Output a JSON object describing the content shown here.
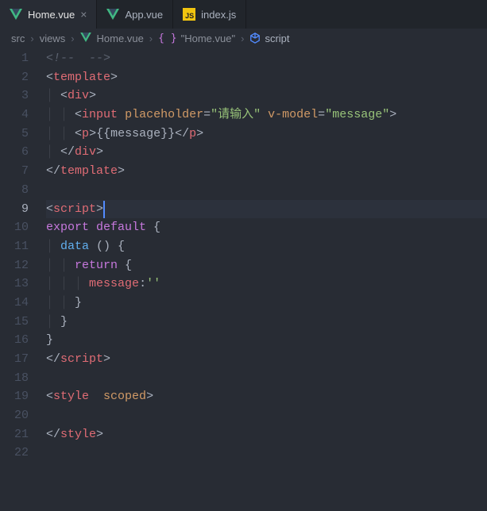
{
  "tabs": [
    {
      "label": "Home.vue",
      "type": "vue",
      "active": true,
      "close": "×"
    },
    {
      "label": "App.vue",
      "type": "vue",
      "active": false
    },
    {
      "label": "index.js",
      "type": "js",
      "active": false
    }
  ],
  "breadcrumbs": {
    "sep": "›",
    "items": [
      {
        "label": "src",
        "icon": null
      },
      {
        "label": "views",
        "icon": null
      },
      {
        "label": "Home.vue",
        "icon": "vue"
      },
      {
        "label": "\"Home.vue\"",
        "icon": "brace"
      },
      {
        "label": "script",
        "icon": "cube"
      }
    ]
  },
  "activeLine": 9,
  "lines": [
    {
      "n": 1,
      "ind": 0,
      "tokens": [
        [
          "<!--  -->",
          "c-comment"
        ]
      ]
    },
    {
      "n": 2,
      "ind": 0,
      "tokens": [
        [
          "<",
          "c-punct"
        ],
        [
          "template",
          "c-tag"
        ],
        [
          ">",
          "c-punct"
        ]
      ]
    },
    {
      "n": 3,
      "ind": 1,
      "tokens": [
        [
          "<",
          "c-punct"
        ],
        [
          "div",
          "c-tag"
        ],
        [
          ">",
          "c-punct"
        ]
      ]
    },
    {
      "n": 4,
      "ind": 2,
      "tokens": [
        [
          "<",
          "c-punct"
        ],
        [
          "input",
          "c-tag"
        ],
        [
          " ",
          "c-default"
        ],
        [
          "placeholder",
          "c-attr"
        ],
        [
          "=",
          "c-punct"
        ],
        [
          "\"请输入\"",
          "c-string"
        ],
        [
          " ",
          "c-default"
        ],
        [
          "v-model",
          "c-attr"
        ],
        [
          "=",
          "c-punct"
        ],
        [
          "\"message\"",
          "c-string"
        ],
        [
          ">",
          "c-punct"
        ]
      ]
    },
    {
      "n": 5,
      "ind": 2,
      "tokens": [
        [
          "<",
          "c-punct"
        ],
        [
          "p",
          "c-tag"
        ],
        [
          ">",
          "c-punct"
        ],
        [
          "{{message}}",
          "c-default"
        ],
        [
          "</",
          "c-punct"
        ],
        [
          "p",
          "c-tag"
        ],
        [
          ">",
          "c-punct"
        ]
      ]
    },
    {
      "n": 6,
      "ind": 1,
      "tokens": [
        [
          "</",
          "c-punct"
        ],
        [
          "div",
          "c-tag"
        ],
        [
          ">",
          "c-punct"
        ]
      ]
    },
    {
      "n": 7,
      "ind": 0,
      "tokens": [
        [
          "</",
          "c-punct"
        ],
        [
          "template",
          "c-tag"
        ],
        [
          ">",
          "c-punct"
        ]
      ]
    },
    {
      "n": 8,
      "ind": 0,
      "tokens": []
    },
    {
      "n": 9,
      "ind": 0,
      "tokens": [
        [
          "<",
          "c-punct"
        ],
        [
          "script",
          "c-tag"
        ],
        [
          ">",
          "c-punct"
        ]
      ]
    },
    {
      "n": 10,
      "ind": 0,
      "tokens": [
        [
          "export",
          "c-keyword"
        ],
        [
          " ",
          "c-default"
        ],
        [
          "default",
          "c-keyword"
        ],
        [
          " {",
          "c-default"
        ]
      ]
    },
    {
      "n": 11,
      "ind": 1,
      "tokens": [
        [
          "data",
          "c-func"
        ],
        [
          " () {",
          "c-default"
        ]
      ]
    },
    {
      "n": 12,
      "ind": 2,
      "tokens": [
        [
          "return",
          "c-keyword"
        ],
        [
          " {",
          "c-default"
        ]
      ]
    },
    {
      "n": 13,
      "ind": 3,
      "tokens": [
        [
          "message",
          "c-prop"
        ],
        [
          ":",
          "c-default"
        ],
        [
          "''",
          "c-string"
        ]
      ]
    },
    {
      "n": 14,
      "ind": 2,
      "tokens": [
        [
          "}",
          "c-default"
        ]
      ]
    },
    {
      "n": 15,
      "ind": 1,
      "tokens": [
        [
          "}",
          "c-default"
        ]
      ]
    },
    {
      "n": 16,
      "ind": 0,
      "tokens": [
        [
          "}",
          "c-default"
        ]
      ]
    },
    {
      "n": 17,
      "ind": 0,
      "tokens": [
        [
          "</",
          "c-punct"
        ],
        [
          "script",
          "c-tag"
        ],
        [
          ">",
          "c-punct"
        ]
      ]
    },
    {
      "n": 18,
      "ind": 0,
      "tokens": []
    },
    {
      "n": 19,
      "ind": 0,
      "tokens": [
        [
          "<",
          "c-punct"
        ],
        [
          "style",
          "c-tag"
        ],
        [
          "  ",
          "c-default"
        ],
        [
          "scoped",
          "c-attr"
        ],
        [
          ">",
          "c-punct"
        ]
      ]
    },
    {
      "n": 20,
      "ind": 0,
      "tokens": []
    },
    {
      "n": 21,
      "ind": 0,
      "tokens": [
        [
          "</",
          "c-punct"
        ],
        [
          "style",
          "c-tag"
        ],
        [
          ">",
          "c-punct"
        ]
      ]
    },
    {
      "n": 22,
      "ind": 0,
      "tokens": []
    }
  ]
}
